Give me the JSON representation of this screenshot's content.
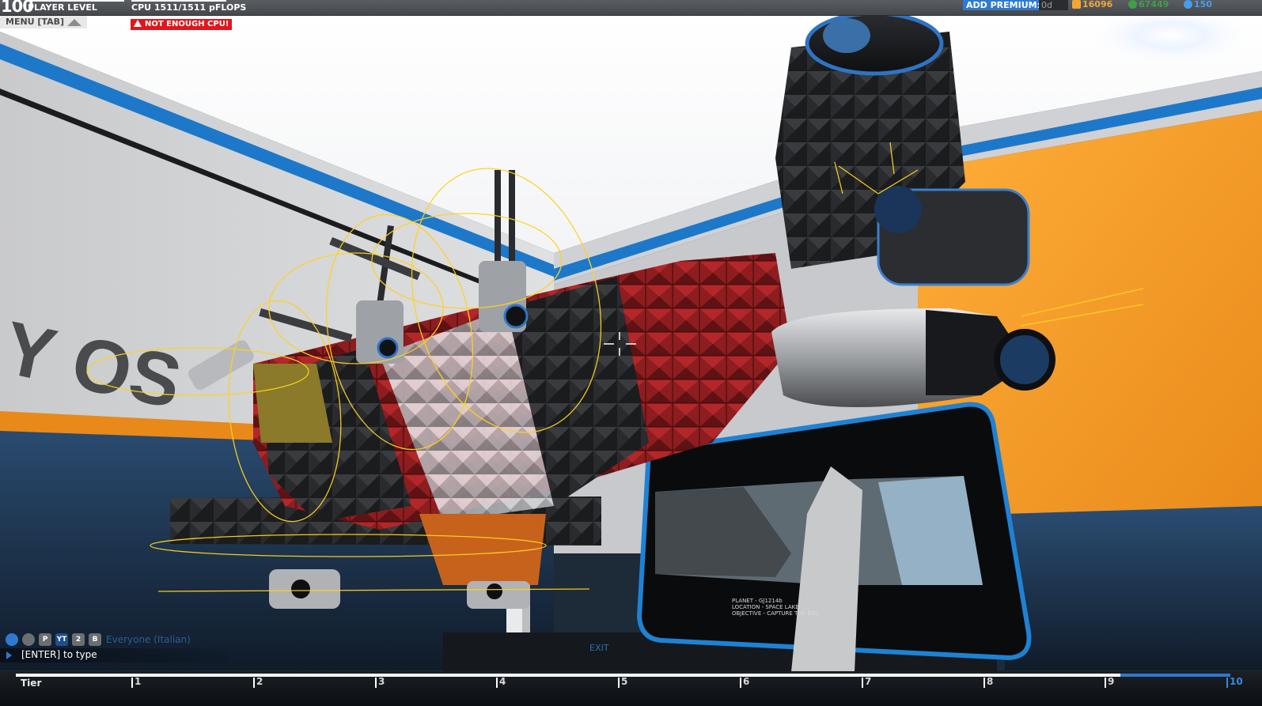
{
  "hud": {
    "player_level": "100",
    "player_level_label": "PLAYER LEVEL",
    "cpu": "CPU 1511/1511 pFLOPS",
    "add_premium_label": "ADD PREMIUM:",
    "premium_days": "0d",
    "robits": "16096",
    "rp": "67449",
    "cc": "150",
    "menu_label": "MENU [TAB]",
    "warning": "NOT ENOUGH CPU!"
  },
  "scene": {
    "wall_logo": "Y OS",
    "screen_lines": [
      "PLANET - GJ1214b",
      "LOCATION - SPACE LAKE",
      "OBJECTIVE - CAPTURE THE BAS"
    ],
    "exit_sign": "EXIT"
  },
  "chat": {
    "icons": [
      "globe",
      "clan",
      "P",
      "YT",
      "2",
      "B"
    ],
    "channel": "Everyone (Italian)",
    "prompt": "[ENTER] to type"
  },
  "tier": {
    "label": "Tier",
    "ticks": [
      "1",
      "2",
      "3",
      "4",
      "5",
      "6",
      "7",
      "8",
      "9",
      "10"
    ],
    "progress": 0.9
  },
  "colors": {
    "accent_blue": "#2e79d2",
    "warning_red": "#e0161c",
    "robits_orange": "#f2a63a",
    "rp_green": "#3f9e4b",
    "cc_blue": "#4c9bea",
    "gizmo_yellow": "#ffd21f"
  }
}
